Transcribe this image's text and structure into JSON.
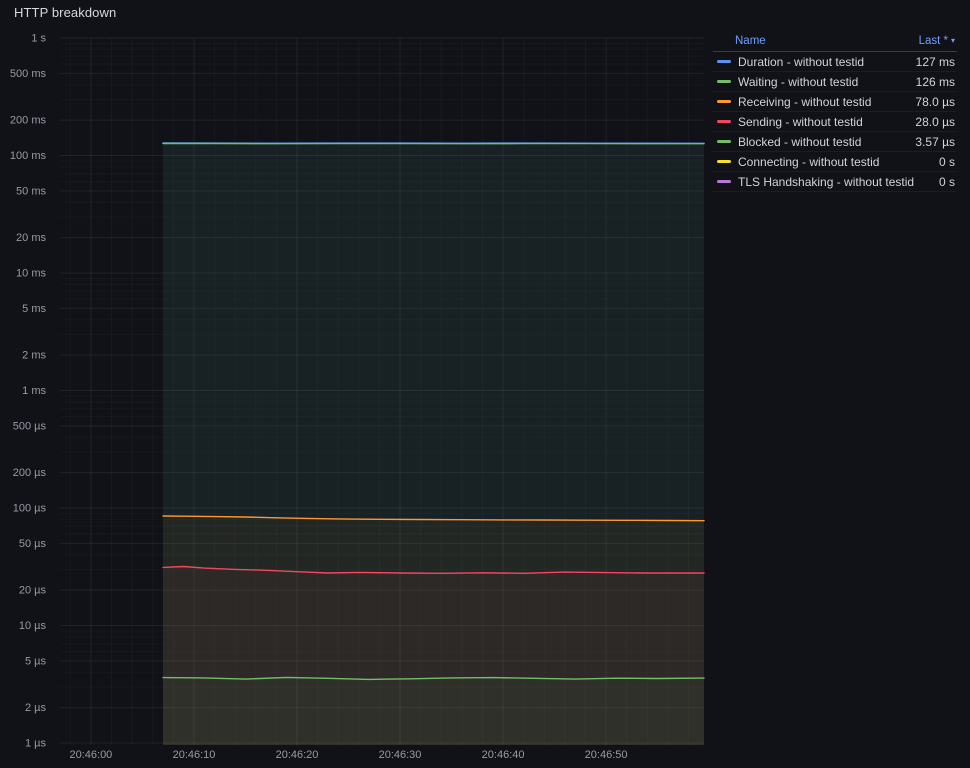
{
  "panel": {
    "title": "HTTP breakdown"
  },
  "legend": {
    "name_header": "Name",
    "value_header": "Last *",
    "sort_caret": "▾",
    "rows": [
      {
        "label": "Duration - without testid",
        "value": "127 ms",
        "color": "#5794F2"
      },
      {
        "label": "Waiting - without testid",
        "value": "126 ms",
        "color": "#73BF69"
      },
      {
        "label": "Receiving - without testid",
        "value": "78.0 µs",
        "color": "#FF9830"
      },
      {
        "label": "Sending - without testid",
        "value": "28.0 µs",
        "color": "#F2495C"
      },
      {
        "label": "Blocked - without testid",
        "value": "3.57 µs",
        "color": "#73BF69"
      },
      {
        "label": "Connecting - without testid",
        "value": "0 s",
        "color": "#FADE2A"
      },
      {
        "label": "TLS Handshaking - without testid",
        "value": "0 s",
        "color": "#B877D9"
      }
    ]
  },
  "chart_data": {
    "type": "line",
    "title": "HTTP breakdown",
    "y_scale": "log10",
    "y_range": [
      1e-06,
      1
    ],
    "x_range_seconds": [
      -3,
      59.5
    ],
    "grid": true,
    "legend_position": "right-table",
    "x_ticks": [
      {
        "t": 0,
        "label": "20:46:00"
      },
      {
        "t": 10,
        "label": "20:46:10"
      },
      {
        "t": 20,
        "label": "20:46:20"
      },
      {
        "t": 30,
        "label": "20:46:30"
      },
      {
        "t": 40,
        "label": "20:46:40"
      },
      {
        "t": 50,
        "label": "20:46:50"
      }
    ],
    "y_ticks": [
      {
        "v": 1,
        "label": "1 s"
      },
      {
        "v": 0.5,
        "label": "500 ms"
      },
      {
        "v": 0.2,
        "label": "200 ms"
      },
      {
        "v": 0.1,
        "label": "100 ms"
      },
      {
        "v": 0.05,
        "label": "50 ms"
      },
      {
        "v": 0.02,
        "label": "20 ms"
      },
      {
        "v": 0.01,
        "label": "10 ms"
      },
      {
        "v": 0.005,
        "label": "5 ms"
      },
      {
        "v": 0.002,
        "label": "2 ms"
      },
      {
        "v": 0.001,
        "label": "1 ms"
      },
      {
        "v": 0.0005,
        "label": "500 µs"
      },
      {
        "v": 0.0002,
        "label": "200 µs"
      },
      {
        "v": 0.0001,
        "label": "100 µs"
      },
      {
        "v": 5e-05,
        "label": "50 µs"
      },
      {
        "v": 2e-05,
        "label": "20 µs"
      },
      {
        "v": 1e-05,
        "label": "10 µs"
      },
      {
        "v": 5e-06,
        "label": "5 µs"
      },
      {
        "v": 2e-06,
        "label": "2 µs"
      },
      {
        "v": 1e-06,
        "label": "1 µs"
      }
    ],
    "series": [
      {
        "name": "Duration - without testid",
        "color": "#5794F2",
        "last": "127 ms",
        "points": [
          [
            7,
            0.1278
          ],
          [
            12,
            0.1276
          ],
          [
            18,
            0.1272
          ],
          [
            24,
            0.1275
          ],
          [
            30,
            0.1274
          ],
          [
            36,
            0.1272
          ],
          [
            42,
            0.1274
          ],
          [
            48,
            0.1273
          ],
          [
            54,
            0.1272
          ],
          [
            59.5,
            0.127
          ]
        ]
      },
      {
        "name": "Waiting - without testid",
        "color": "#73BF69",
        "last": "126 ms",
        "points": [
          [
            7,
            0.1266
          ],
          [
            12,
            0.1264
          ],
          [
            18,
            0.1261
          ],
          [
            24,
            0.1263
          ],
          [
            30,
            0.1262
          ],
          [
            36,
            0.1261
          ],
          [
            42,
            0.1263
          ],
          [
            48,
            0.1262
          ],
          [
            54,
            0.1261
          ],
          [
            59.5,
            0.126
          ]
        ]
      },
      {
        "name": "Receiving - without testid",
        "color": "#FF9830",
        "last": "78.0 µs",
        "points": [
          [
            7,
            8.55e-05
          ],
          [
            9,
            8.52e-05
          ],
          [
            12,
            8.45e-05
          ],
          [
            15,
            8.38e-05
          ],
          [
            18,
            8.25e-05
          ],
          [
            21,
            8.15e-05
          ],
          [
            24,
            8.08e-05
          ],
          [
            28,
            8.02e-05
          ],
          [
            32,
            7.98e-05
          ],
          [
            36,
            7.95e-05
          ],
          [
            40,
            7.92e-05
          ],
          [
            44,
            7.9e-05
          ],
          [
            48,
            7.88e-05
          ],
          [
            52,
            7.86e-05
          ],
          [
            56,
            7.83e-05
          ],
          [
            59.5,
            7.8e-05
          ]
        ]
      },
      {
        "name": "Sending - without testid",
        "color": "#F2495C",
        "last": "28.0 µs",
        "points": [
          [
            7,
            3.12e-05
          ],
          [
            9,
            3.18e-05
          ],
          [
            11,
            3.08e-05
          ],
          [
            14,
            3e-05
          ],
          [
            17,
            2.95e-05
          ],
          [
            20,
            2.87e-05
          ],
          [
            23,
            2.8e-05
          ],
          [
            26,
            2.83e-05
          ],
          [
            30,
            2.8e-05
          ],
          [
            34,
            2.78e-05
          ],
          [
            38,
            2.81e-05
          ],
          [
            42,
            2.78e-05
          ],
          [
            46,
            2.85e-05
          ],
          [
            50,
            2.82e-05
          ],
          [
            54,
            2.8e-05
          ],
          [
            59.5,
            2.8e-05
          ]
        ]
      },
      {
        "name": "Blocked - without testid",
        "color": "#73BF69",
        "last": "3.57 µs",
        "points": [
          [
            7,
            3.6e-06
          ],
          [
            11,
            3.58e-06
          ],
          [
            15,
            3.5e-06
          ],
          [
            19,
            3.62e-06
          ],
          [
            23,
            3.55e-06
          ],
          [
            27,
            3.48e-06
          ],
          [
            31,
            3.52e-06
          ],
          [
            35,
            3.58e-06
          ],
          [
            39,
            3.6e-06
          ],
          [
            43,
            3.55e-06
          ],
          [
            47,
            3.5e-06
          ],
          [
            51,
            3.56e-06
          ],
          [
            55,
            3.54e-06
          ],
          [
            59.5,
            3.57e-06
          ]
        ]
      },
      {
        "name": "Connecting - without testid",
        "color": "#FADE2A",
        "last": "0 s",
        "points": []
      },
      {
        "name": "TLS Handshaking - without testid",
        "color": "#B877D9",
        "last": "0 s",
        "points": []
      }
    ]
  }
}
